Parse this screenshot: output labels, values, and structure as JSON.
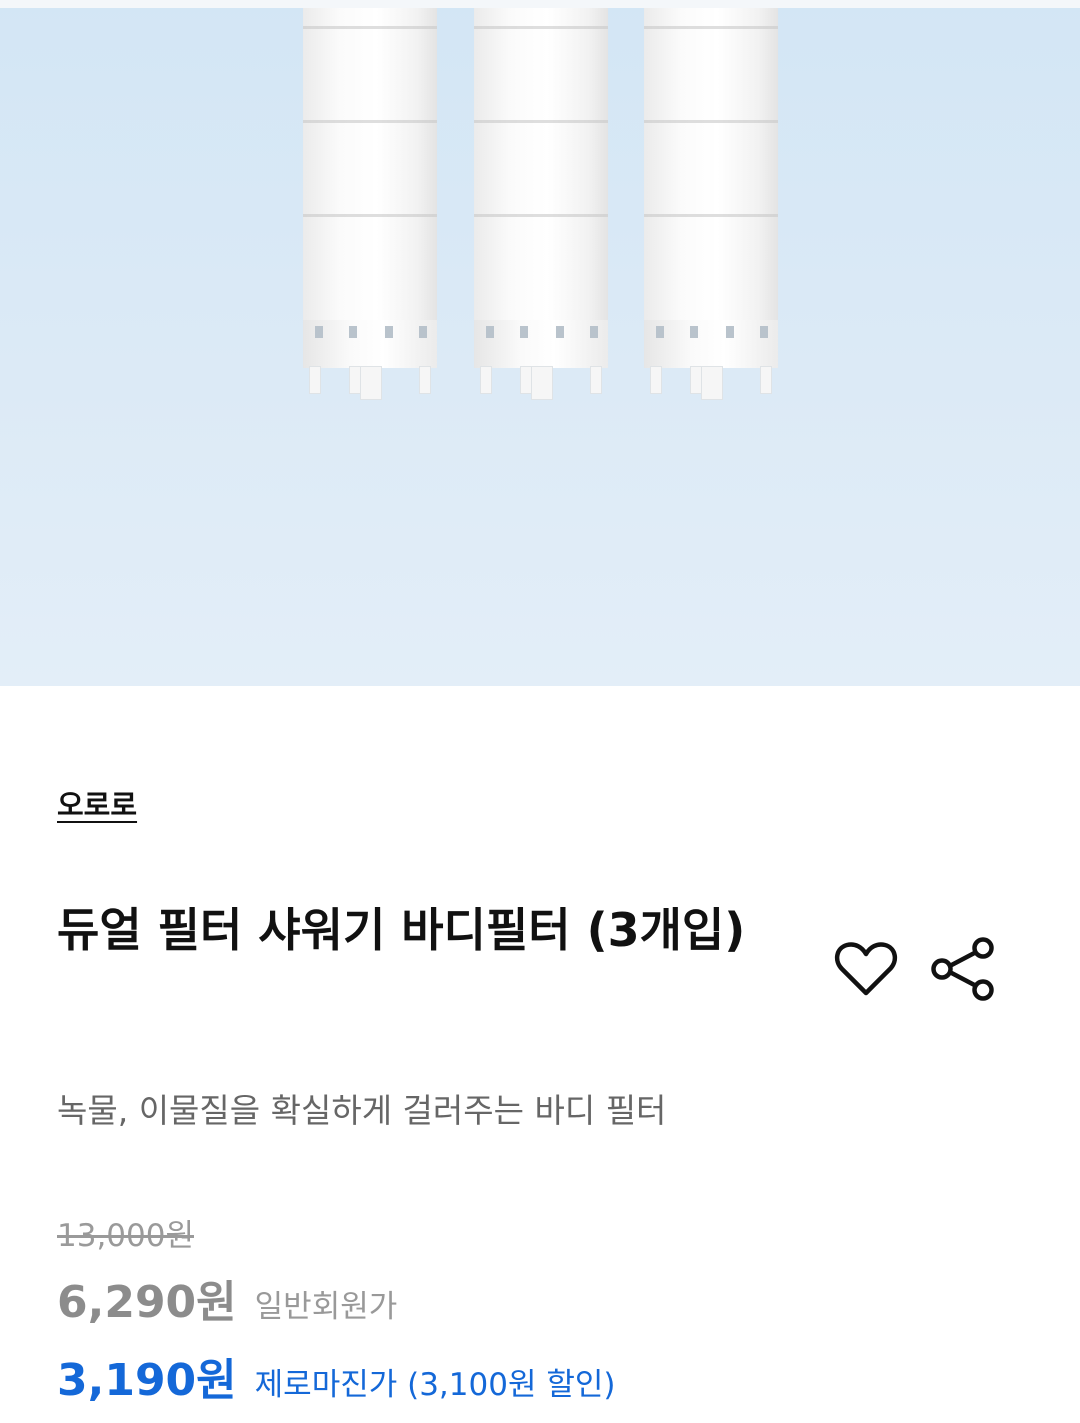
{
  "product": {
    "brand": "오로로",
    "title": "듀얼 필터 샤워기 바디필터 (3개입)",
    "description": "녹물, 이물질을 확실하게 걸러주는 바디 필터"
  },
  "icons": {
    "wishlist": "heart-outline-icon",
    "share": "share-icon"
  },
  "pricing": {
    "original_price": "13,000원",
    "member_price": "6,290원",
    "member_label": "일반회원가",
    "zero_margin_price": "3,190원",
    "zero_margin_label": "제로마진가 (3,100원 할인)"
  },
  "colors": {
    "accent": "#1468d8",
    "hero_background": "#d9e9f6",
    "muted_text": "#999999"
  }
}
